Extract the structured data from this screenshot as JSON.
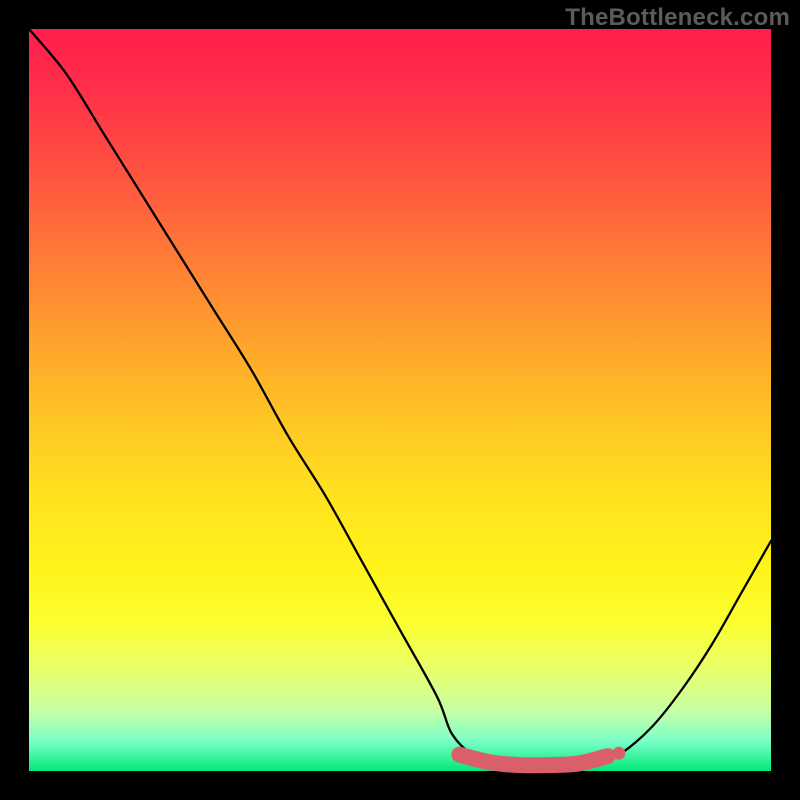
{
  "watermark": "TheBottleneck.com",
  "colors": {
    "frame": "#000000",
    "curve": "#000000",
    "marker_fill": "#d9606a",
    "marker_edge": "#c94f59"
  },
  "chart_data": {
    "type": "line",
    "title": "",
    "xlabel": "",
    "ylabel": "",
    "xlim": [
      0,
      100
    ],
    "ylim": [
      0,
      100
    ],
    "grid": false,
    "legend": null,
    "series": [
      {
        "name": "bottleneck-curve",
        "x": [
          0,
          5,
          10,
          15,
          20,
          25,
          30,
          35,
          40,
          45,
          50,
          55,
          57,
          60,
          63,
          67,
          70,
          73,
          77,
          80,
          84,
          88,
          92,
          96,
          100
        ],
        "y": [
          100,
          94,
          86,
          78,
          70,
          62,
          54,
          45,
          37,
          28,
          19,
          10,
          5,
          2,
          1,
          0.6,
          0.6,
          0.6,
          1,
          2.5,
          6,
          11,
          17,
          24,
          31
        ]
      }
    ],
    "markers": [
      {
        "name": "optimal-range-start",
        "x": 58,
        "y": 2.2
      },
      {
        "name": "optimal-range-mid1",
        "x": 62,
        "y": 1.2
      },
      {
        "name": "optimal-range-mid2",
        "x": 66,
        "y": 0.8
      },
      {
        "name": "optimal-range-mid3",
        "x": 70,
        "y": 0.8
      },
      {
        "name": "optimal-range-mid4",
        "x": 74,
        "y": 1.0
      },
      {
        "name": "optimal-range-end",
        "x": 78,
        "y": 2.0
      }
    ]
  }
}
